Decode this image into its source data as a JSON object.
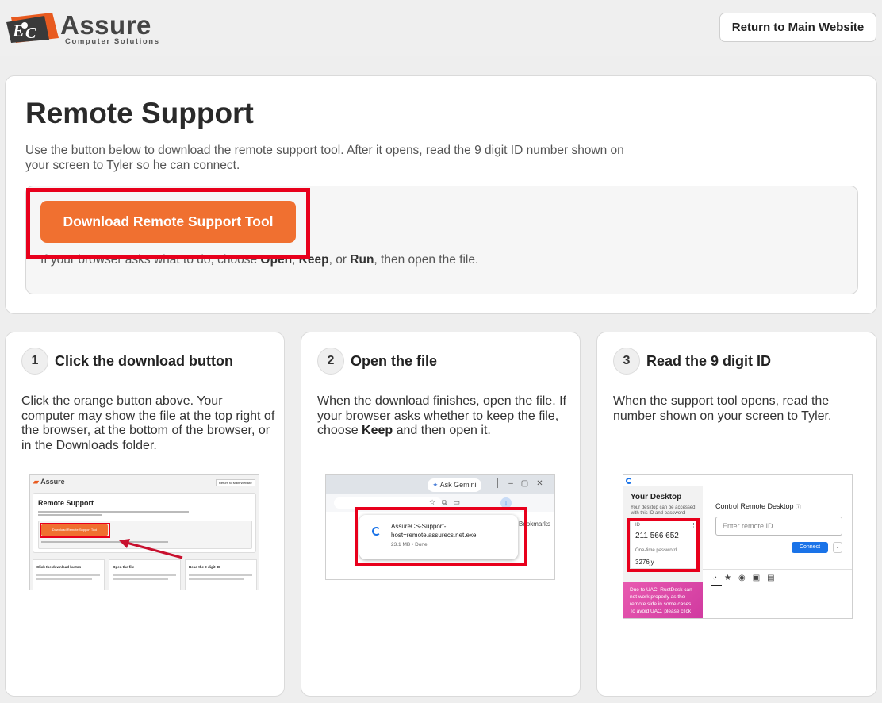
{
  "header": {
    "logo_text": "Assure",
    "logo_subtext": "Computer Solutions",
    "return_label": "Return to Main Website"
  },
  "main": {
    "title": "Remote Support",
    "description": "Use the button below to download the remote support tool. After it opens, read the 9 digit ID number shown on your screen to Tyler so he can connect.",
    "download_label": "Download Remote Support Tool",
    "note_prefix": "If your browser asks what to do, choose ",
    "note_open": "Open",
    "note_sep1": ", ",
    "note_keep": "Keep",
    "note_sep2": ", or ",
    "note_run": "Run",
    "note_suffix": ", then open the file."
  },
  "steps": [
    {
      "number": "1",
      "title": "Click the download button",
      "text": "Click the orange button above. Your computer may show the file at the top right of the browser, at the bottom of the browser, or in the Downloads folder."
    },
    {
      "number": "2",
      "title": "Open the file",
      "text_prefix": "When the download finishes, open the file. If your browser asks whether to keep the file, choose ",
      "text_keep": "Keep",
      "text_suffix": " and then open it."
    },
    {
      "number": "3",
      "title": "Read the 9 digit ID",
      "text": "When the support tool opens, read the number shown on your screen to Tyler."
    }
  ],
  "shot1": {
    "return_label": "Return to Main Website",
    "title": "Remote Support",
    "button": "Download Remote Support Tool",
    "s1": "Click the download button",
    "s2": "Open the file",
    "s3": "Read the 9 digit ID"
  },
  "shot2": {
    "tab_label": "Ask Gemini",
    "bookmarks": "Bookmarks",
    "file_name_1": "AssureCS-Support-",
    "file_name_2": "host=remote.assurecs.net.exe",
    "file_meta": "23.1 MB • Done"
  },
  "shot3": {
    "your_desktop": "Your Desktop",
    "desktop_desc": "Your desktop can be accessed with this ID and password",
    "id_label": "ID",
    "id_value": "211 566 652",
    "otp_label": "One-time password",
    "otp_value": "3276jy",
    "control_title": "Control Remote Desktop",
    "remote_placeholder": "Enter remote ID",
    "connect": "Connect",
    "uac_note": "Due to UAC, RustDesk can not work properly as the remote side in some cases. To avoid UAC, please click"
  },
  "colors": {
    "accent": "#f07030",
    "highlight": "#e8001c",
    "connect_blue": "#1a73e8"
  }
}
